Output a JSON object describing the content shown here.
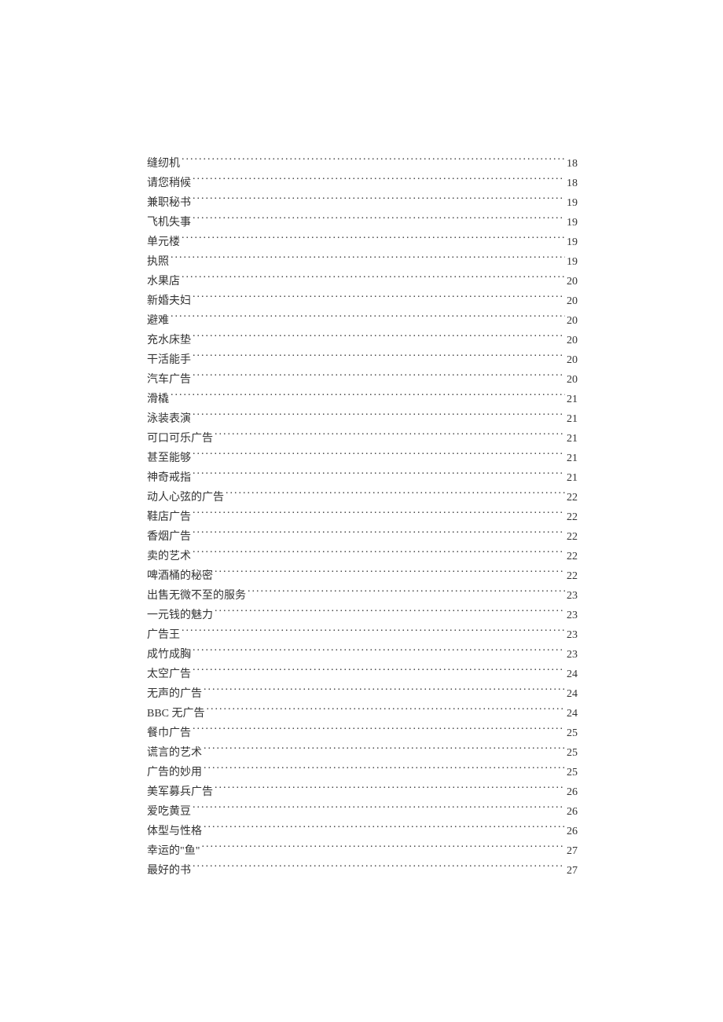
{
  "toc": {
    "entries": [
      {
        "title": "缝纫机",
        "page": "18"
      },
      {
        "title": "请您稍候",
        "page": "18"
      },
      {
        "title": "兼职秘书",
        "page": "19"
      },
      {
        "title": "飞机失事",
        "page": "19"
      },
      {
        "title": "单元楼",
        "page": "19"
      },
      {
        "title": "执照",
        "page": "19"
      },
      {
        "title": "水果店",
        "page": "20"
      },
      {
        "title": "新婚夫妇",
        "page": "20"
      },
      {
        "title": "避难",
        "page": "20"
      },
      {
        "title": "充水床垫",
        "page": "20"
      },
      {
        "title": "干活能手",
        "page": "20"
      },
      {
        "title": "汽车广告",
        "page": "20"
      },
      {
        "title": "滑橇",
        "page": "21"
      },
      {
        "title": "泳装表演",
        "page": "21"
      },
      {
        "title": "可口可乐广告",
        "page": "21"
      },
      {
        "title": "甚至能够",
        "page": "21"
      },
      {
        "title": "神奇戒指",
        "page": "21"
      },
      {
        "title": "动人心弦的广告",
        "page": "22"
      },
      {
        "title": "鞋店广告",
        "page": "22"
      },
      {
        "title": "香烟广告",
        "page": "22"
      },
      {
        "title": "卖的艺术",
        "page": "22"
      },
      {
        "title": "啤酒桶的秘密",
        "page": "22"
      },
      {
        "title": "出售无微不至的服务",
        "page": "23"
      },
      {
        "title": "一元钱的魅力",
        "page": "23"
      },
      {
        "title": "广告王",
        "page": "23"
      },
      {
        "title": "成竹成胸",
        "page": "23"
      },
      {
        "title": "太空广告",
        "page": "24"
      },
      {
        "title": "无声的广告",
        "page": "24"
      },
      {
        "title": "BBC 无广告 ",
        "page": "24"
      },
      {
        "title": "餐巾广告",
        "page": "25"
      },
      {
        "title": "谎言的艺术",
        "page": "25"
      },
      {
        "title": "广告的妙用",
        "page": "25"
      },
      {
        "title": "美军募兵广告",
        "page": "26"
      },
      {
        "title": "爱吃黄豆",
        "page": "26"
      },
      {
        "title": "体型与性格",
        "page": "26"
      },
      {
        "title": "幸运的\"鱼\"",
        "page": "27"
      },
      {
        "title": "最好的书",
        "page": "27"
      }
    ]
  }
}
